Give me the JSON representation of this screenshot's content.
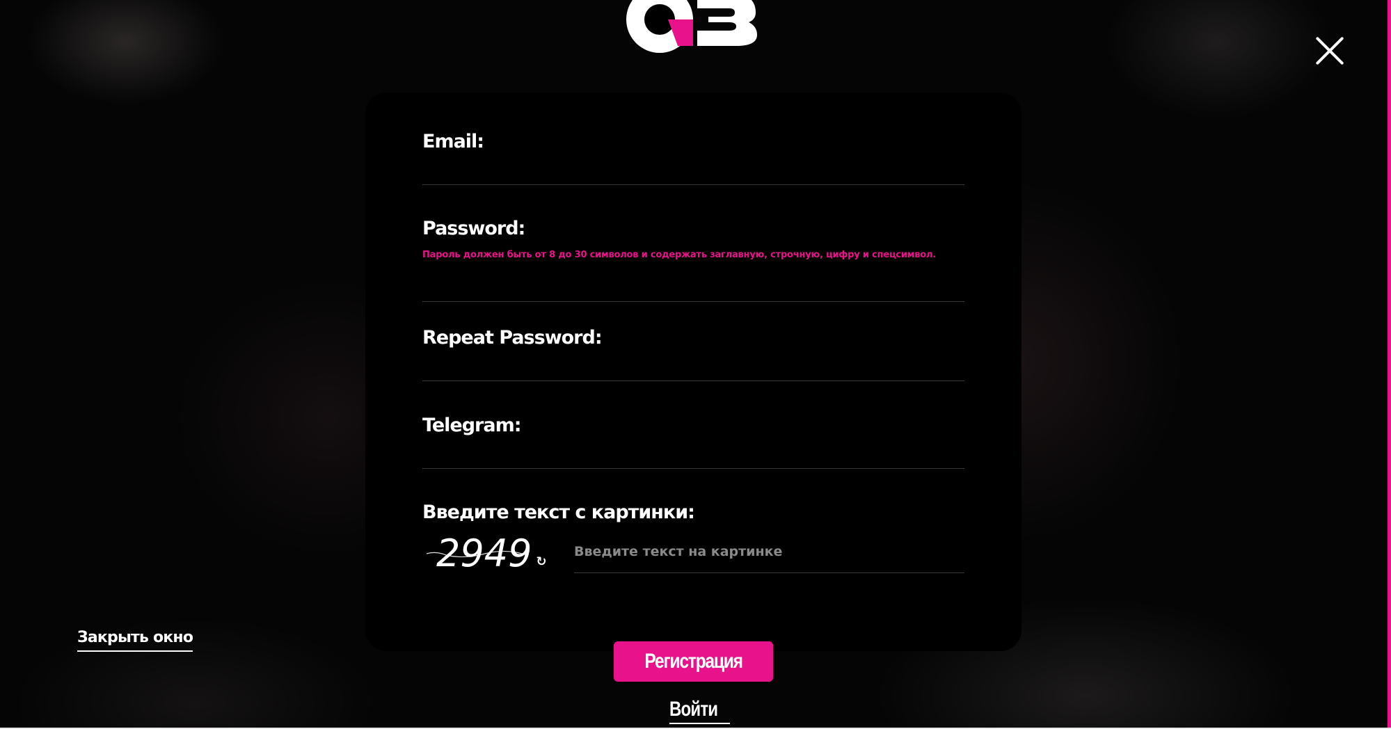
{
  "brand": {
    "logo_icon": "brand-logo",
    "accent_color": "#e8138a"
  },
  "close_icon": "close-x-icon",
  "form": {
    "email": {
      "label": "Email:",
      "value": ""
    },
    "password": {
      "label": "Password:",
      "hint": "Пароль должен быть от 8 до 30 символов и содержать заглавную, строчную, цифру и спецсимвол.",
      "value": ""
    },
    "repeat_password": {
      "label": "Repeat Password:",
      "value": ""
    },
    "telegram": {
      "label": "Telegram:",
      "value": ""
    },
    "captcha": {
      "label": "Введите текст с картинки:",
      "image_text": "2949",
      "refresh_icon": "refresh-icon",
      "placeholder": "Введите текст на картинке",
      "value": ""
    }
  },
  "actions": {
    "close_window": "Закрыть окно",
    "register": "Регистрация",
    "login": "Войти"
  }
}
